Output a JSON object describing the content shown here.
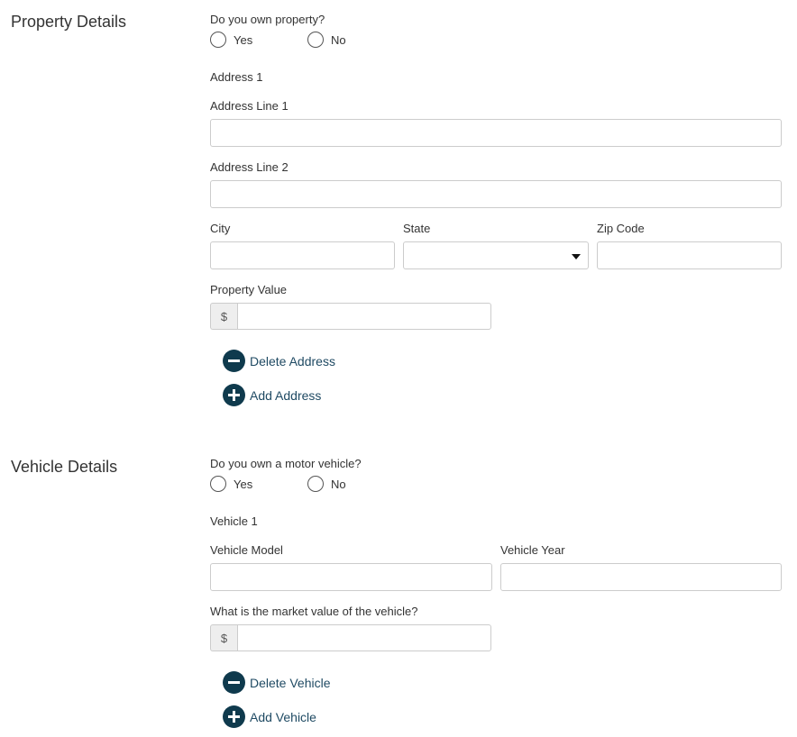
{
  "property": {
    "section_title": "Property Details",
    "question": "Do you own property?",
    "yes_label": "Yes",
    "no_label": "No",
    "address_heading": "Address 1",
    "address_line1_label": "Address Line 1",
    "address_line2_label": "Address Line 2",
    "city_label": "City",
    "state_label": "State",
    "zip_label": "Zip Code",
    "value_label": "Property Value",
    "currency_symbol": "$",
    "delete_label": "Delete Address",
    "add_label": "Add Address"
  },
  "vehicle": {
    "section_title": "Vehicle Details",
    "question": "Do you own a motor vehicle?",
    "yes_label": "Yes",
    "no_label": "No",
    "vehicle_heading": "Vehicle 1",
    "model_label": "Vehicle Model",
    "year_label": "Vehicle Year",
    "value_label": "What is the market value of the vehicle?",
    "currency_symbol": "$",
    "delete_label": "Delete Vehicle",
    "add_label": "Add Vehicle"
  },
  "icons": {
    "delete": "minus-circle-icon",
    "add": "plus-circle-icon",
    "dropdown": "caret-down-icon"
  },
  "colors": {
    "action_icon": "#0f3a4d",
    "action_text": "#1f4a63",
    "input_border": "#cccccc",
    "addon_bg": "#eeeeee"
  }
}
